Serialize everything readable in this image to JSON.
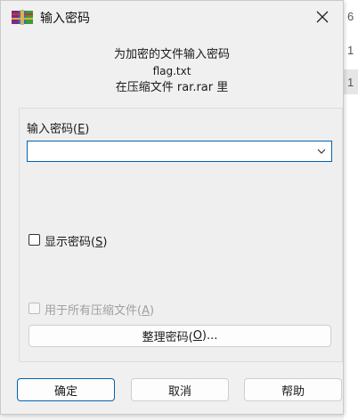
{
  "window": {
    "title": "输入密码",
    "header_line1": "为加密的文件输入密码",
    "file_name": "flag.txt",
    "header_line3": "在压缩文件 rar.rar 里"
  },
  "password_field": {
    "label_prefix": "输入密码(",
    "label_hotkey": "E",
    "label_suffix": ")",
    "value": "",
    "focus_color": "#0063b1"
  },
  "show_password": {
    "label_prefix": "显示密码(",
    "label_hotkey": "S",
    "label_suffix": ")",
    "checked": false
  },
  "use_for_all": {
    "label_prefix": "用于所有压缩文件(",
    "label_hotkey": "A",
    "label_suffix": ")",
    "checked": false,
    "enabled": false
  },
  "buttons": {
    "organize_prefix": "整理密码(",
    "organize_hotkey": "O",
    "organize_suffix": ")...",
    "ok": "确定",
    "cancel": "取消",
    "help": "帮助"
  },
  "background_window": {
    "digits": [
      "6",
      "1",
      "1"
    ]
  },
  "icons": {
    "app": "winrar-books-icon",
    "close": "close-icon",
    "dropdown": "chevron-down-icon"
  }
}
